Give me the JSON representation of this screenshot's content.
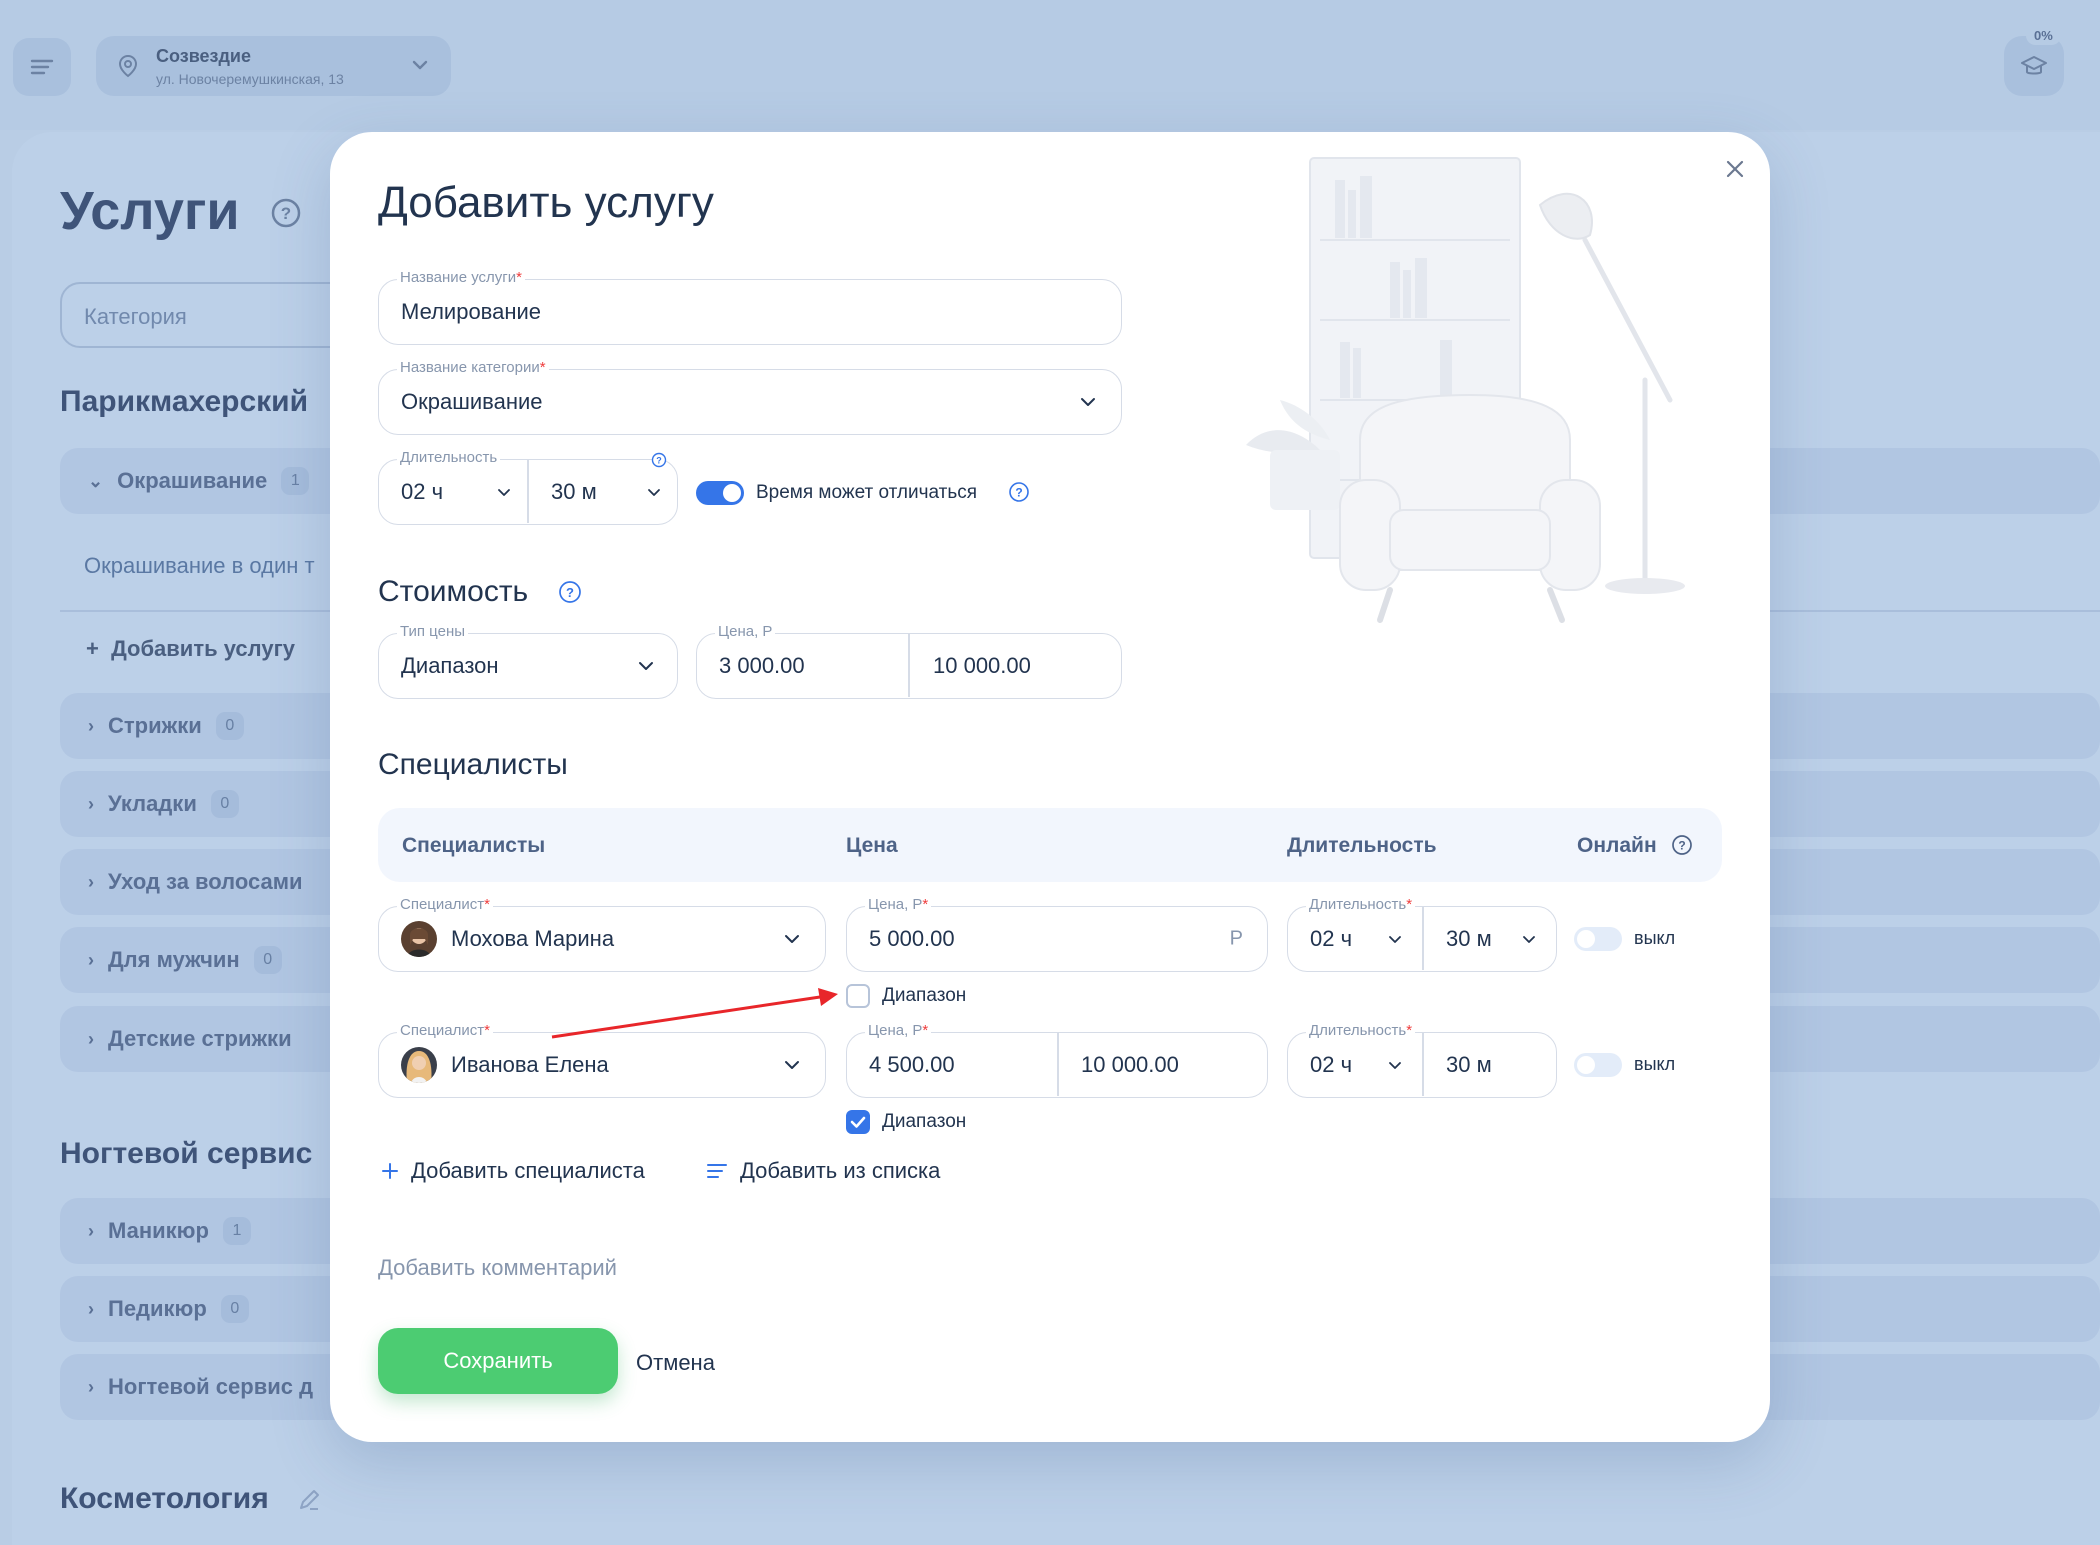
{
  "app": {
    "location_name": "Созвездие",
    "location_address": "ул. Новочеремушкинская, 13",
    "progress": "0%"
  },
  "background": {
    "page_title": "Услуги",
    "search_placeholder": "Категория",
    "groups": [
      {
        "title": "Парикмахерский",
        "categories": [
          {
            "label": "Окрашивание",
            "count": "1"
          },
          {
            "label": "Стрижки",
            "count": "0"
          },
          {
            "label": "Укладки",
            "count": "0"
          },
          {
            "label": "Уход за волосами",
            "count": ""
          },
          {
            "label": "Для мужчин",
            "count": "0"
          },
          {
            "label": "Детские стрижки",
            "count": ""
          }
        ],
        "service_item": "Окрашивание в один т",
        "add_service": "Добавить услугу"
      },
      {
        "title": "Ногтевой сервис",
        "categories": [
          {
            "label": "Маникюр",
            "count": "1"
          },
          {
            "label": "Педикюр",
            "count": "0"
          },
          {
            "label": "Ногтевой сервис д",
            "count": ""
          }
        ]
      },
      {
        "title": "Косметология",
        "categories": []
      }
    ]
  },
  "modal": {
    "title": "Добавить услугу",
    "service_name": {
      "label": "Название услуги",
      "value": "Мелирование"
    },
    "category": {
      "label": "Название категории",
      "value": "Окрашивание"
    },
    "duration": {
      "label": "Длительность",
      "hours": "02 ч",
      "minutes": "30 м"
    },
    "time_may_vary": {
      "label": "Время может отличаться",
      "enabled": true
    },
    "cost_section": "Стоимость",
    "price_type": {
      "label": "Тип цены",
      "value": "Диапазон"
    },
    "price": {
      "label": "Цена, Р",
      "from": "3 000.00",
      "to": "10 000.00"
    },
    "specialists_section": "Специалисты",
    "table_headers": {
      "specialists": "Специалисты",
      "price": "Цена",
      "duration": "Длительность",
      "online": "Онлайн"
    },
    "rows": [
      {
        "specialist_label": "Специалист",
        "specialist": "Мохова Марина",
        "price_label": "Цена, Р",
        "price": "5 000.00",
        "currency": "Р",
        "range_label": "Диапазон",
        "range_checked": false,
        "duration_label": "Длительность",
        "hours": "02 ч",
        "minutes": "30 м",
        "online": "выкл"
      },
      {
        "specialist_label": "Специалист",
        "specialist": "Иванова Елена",
        "price_label": "Цена, Р",
        "price_from": "4 500.00",
        "price_to": "10 000.00",
        "range_label": "Диапазон",
        "range_checked": true,
        "duration_label": "Длительность",
        "hours": "02 ч",
        "minutes": "30 м",
        "online": "выкл"
      }
    ],
    "add_specialist": "Добавить специалиста",
    "add_from_list": "Добавить из списка",
    "add_comment": "Добавить комментарий",
    "save": "Сохранить",
    "cancel": "Отмена"
  },
  "colors": {
    "accent": "#3575e8",
    "save_green": "#4ccc72",
    "required": "#ef3c3c",
    "annotation_arrow": "#e8262a"
  },
  "icons": [
    "menu-icon",
    "location-pin-icon",
    "chevron-down-icon",
    "graduation-cap-icon",
    "help-icon",
    "close-icon",
    "plus-icon",
    "list-icon",
    "checkmark-icon",
    "edit-icon"
  ]
}
